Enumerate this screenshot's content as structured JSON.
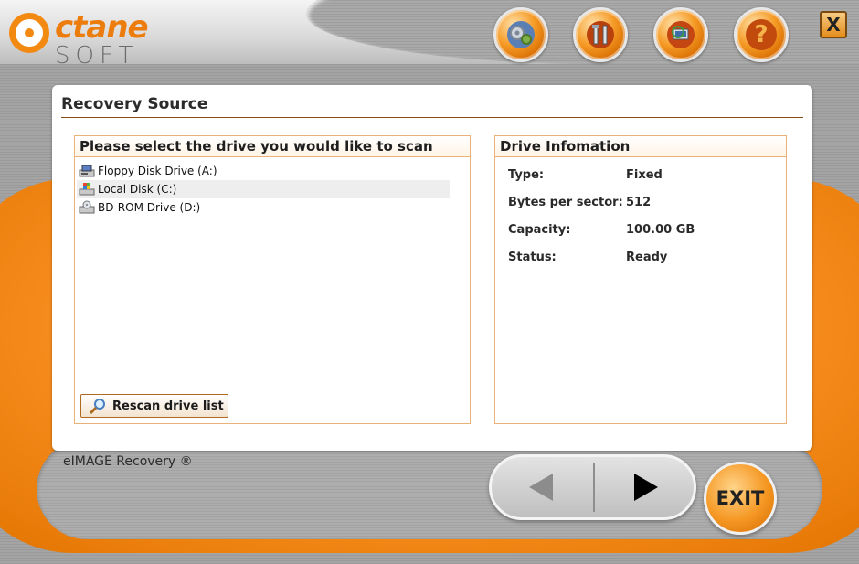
{
  "app": {
    "logo_main": "ctane",
    "logo_sub": "SOFT",
    "close_label": "X",
    "product_name": "eIMAGE Recovery ®"
  },
  "toolbar": {
    "buttons": [
      {
        "name": "settings",
        "icon": "gears-icon"
      },
      {
        "name": "tools",
        "icon": "tools-icon"
      },
      {
        "name": "network",
        "icon": "network-icon"
      },
      {
        "name": "help",
        "icon": "help-icon",
        "glyph": "?"
      }
    ]
  },
  "page": {
    "title": "Recovery Source"
  },
  "drive_panel": {
    "header": "Please select the drive you would like to scan",
    "drives": [
      {
        "label": "Floppy Disk Drive (A:)",
        "icon": "floppy-drive-icon",
        "selected": false
      },
      {
        "label": "Local Disk (C:)",
        "icon": "local-disk-icon",
        "selected": true
      },
      {
        "label": "BD-ROM Drive (D:)",
        "icon": "optical-drive-icon",
        "selected": false
      }
    ],
    "rescan_label": "Rescan drive list"
  },
  "info_panel": {
    "header": "Drive Infomation",
    "rows": [
      {
        "label": "Type:",
        "value": "Fixed"
      },
      {
        "label": "Bytes per sector:",
        "value": "512"
      },
      {
        "label": "Capacity:",
        "value": "100.00 GB"
      },
      {
        "label": "Status:",
        "value": "Ready"
      }
    ]
  },
  "nav": {
    "exit_label": "EXIT"
  },
  "colors": {
    "accent_orange": "#f28a12",
    "border_orange": "#e9b27a",
    "rule_brown": "#8a4d12"
  }
}
